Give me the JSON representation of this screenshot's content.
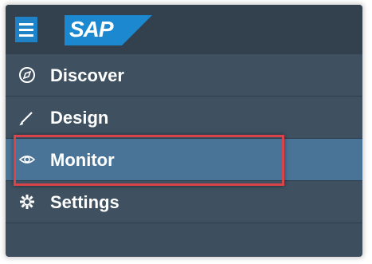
{
  "app": {
    "logo_text": "SAP"
  },
  "nav": {
    "items": [
      {
        "label": "Discover",
        "icon": "compass-icon",
        "active": false
      },
      {
        "label": "Design",
        "icon": "pencil-icon",
        "active": false
      },
      {
        "label": "Monitor",
        "icon": "eye-icon",
        "active": true
      },
      {
        "label": "Settings",
        "icon": "gear-icon",
        "active": false
      }
    ]
  },
  "colors": {
    "header": "#33414f",
    "sidebar": "#3f5161",
    "active": "#4a7497",
    "highlight": "#d9434a",
    "menu_button": "#1f82c6"
  }
}
